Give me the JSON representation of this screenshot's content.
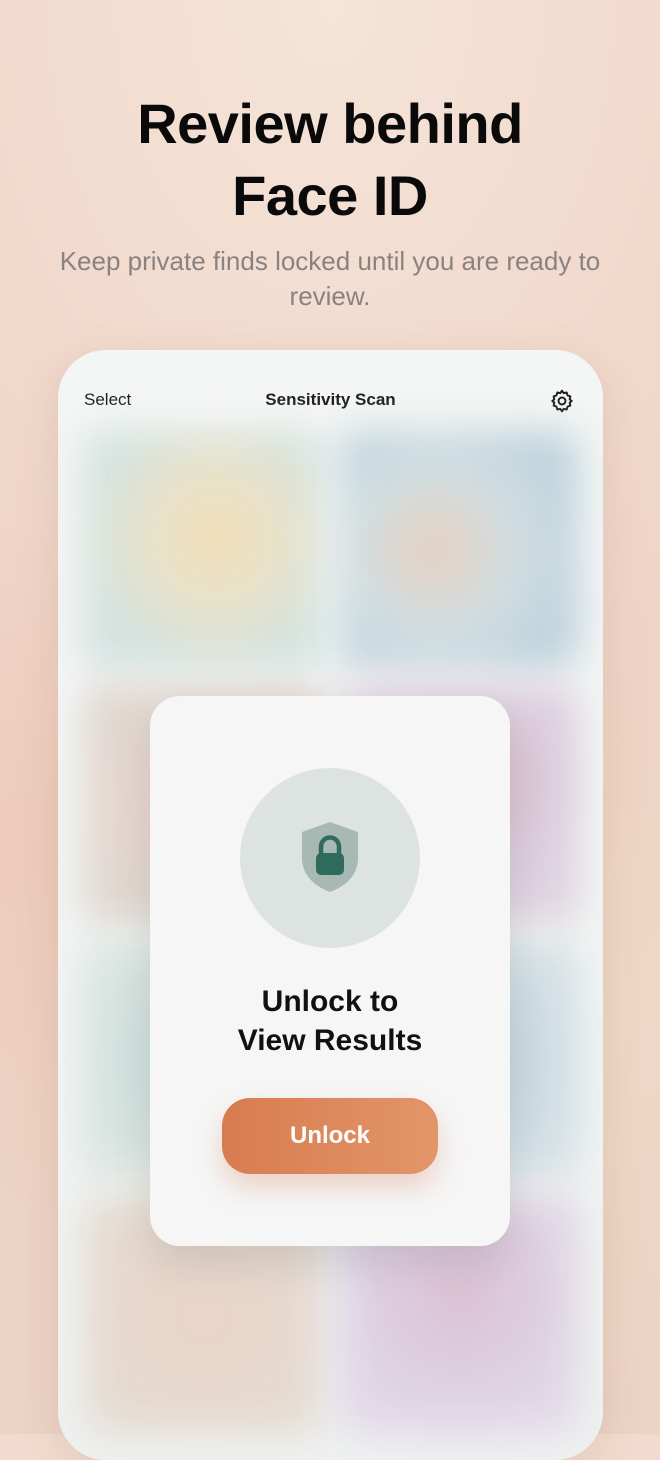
{
  "promo": {
    "headline_line1": "Review behind",
    "headline_line2": "Face ID",
    "subheadline": "Keep private finds locked until you are ready to review."
  },
  "nav": {
    "left_label": "Select",
    "title": "Sensitivity Scan",
    "right_icon": "gear-icon"
  },
  "lock_card": {
    "icon": "shield-lock-icon",
    "title_line1": "Unlock to",
    "title_line2": "View Results",
    "button_label": "Unlock"
  },
  "colors": {
    "accent": "#D98255",
    "shield": "#A8B8B2",
    "lock": "#2F6B5C"
  }
}
